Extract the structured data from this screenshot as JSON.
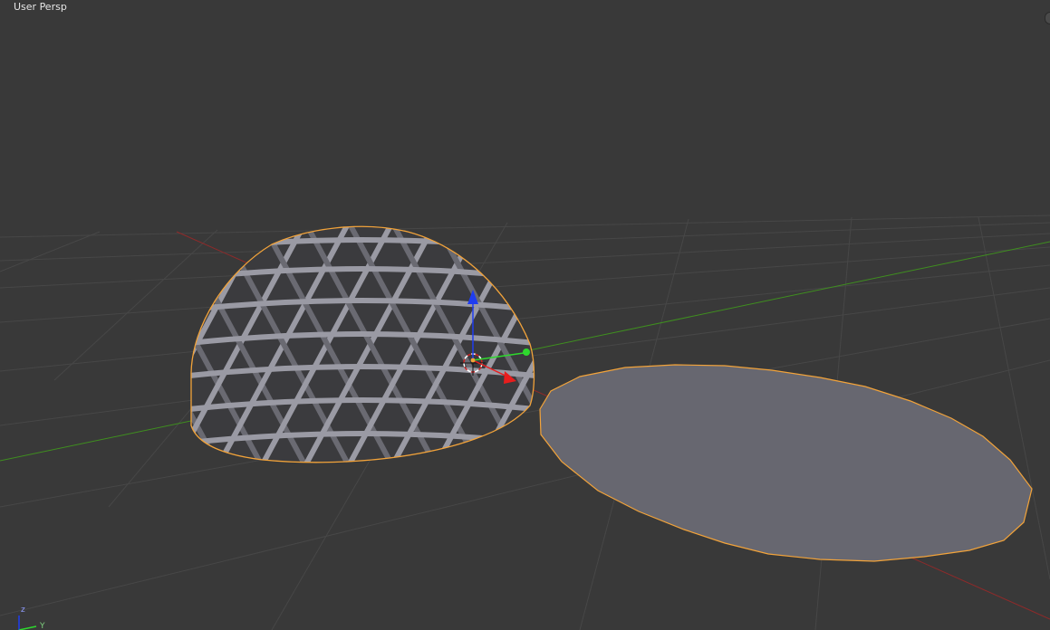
{
  "viewport": {
    "view_label": "User Persp",
    "nav_axes": {
      "z_label": "z",
      "y_label": "Y"
    }
  },
  "colors": {
    "background": "#393939",
    "grid": "#474747",
    "x_axis": "#8f2a2a",
    "y_axis": "#3f8f1f",
    "selection_outline": "#f2a33a",
    "mesh_face": "#676770",
    "strut": "#9a9aa4",
    "strut_dark": "#6a6a72",
    "gizmo_z": "#1f3df0",
    "gizmo_y": "#2ed82e",
    "gizmo_x": "#e81d1d"
  },
  "icons": {
    "cursor": "3d-cursor-icon",
    "transform": "transform-gizmo-icon",
    "axes": "axes-navigator-icon"
  }
}
